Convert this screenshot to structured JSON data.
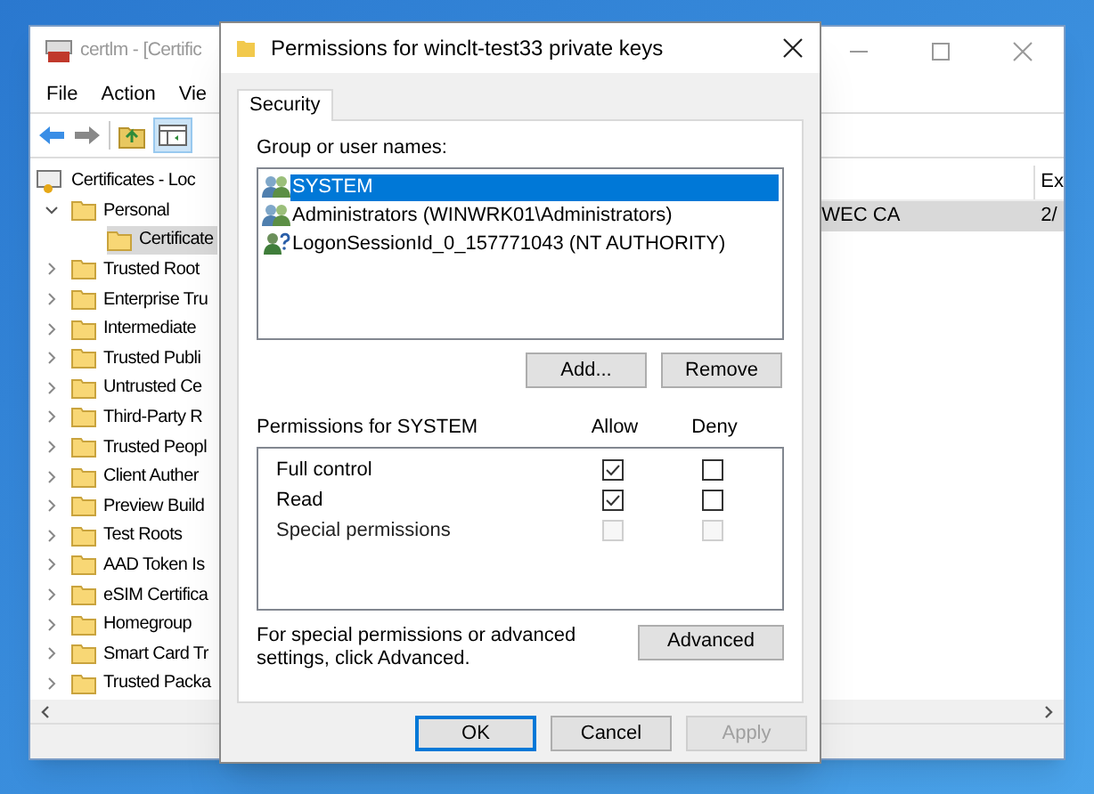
{
  "main_window": {
    "title": "certlm - [Certific",
    "menu": [
      "File",
      "Action",
      "Vie"
    ],
    "tree": {
      "label": "Certificates - Loc",
      "selected": false,
      "children": [
        {
          "label": "Personal",
          "expanded": true,
          "selected": false,
          "children": [
            {
              "label": "Certificate",
              "selected": true
            }
          ]
        },
        {
          "label": "Trusted Root",
          "expanded": false,
          "selected": false
        },
        {
          "label": "Enterprise Tru",
          "expanded": false,
          "selected": false
        },
        {
          "label": "Intermediate",
          "expanded": false,
          "selected": false
        },
        {
          "label": "Trusted Publi",
          "expanded": false,
          "selected": false
        },
        {
          "label": "Untrusted Ce",
          "expanded": false,
          "selected": false
        },
        {
          "label": "Third-Party R",
          "expanded": false,
          "selected": false
        },
        {
          "label": "Trusted Peopl",
          "expanded": false,
          "selected": false
        },
        {
          "label": "Client Auther",
          "expanded": false,
          "selected": false
        },
        {
          "label": "Preview Build",
          "expanded": false,
          "selected": false
        },
        {
          "label": "Test Roots",
          "expanded": false,
          "selected": false
        },
        {
          "label": "AAD Token Is",
          "expanded": false,
          "selected": false
        },
        {
          "label": "eSIM Certifica",
          "expanded": false,
          "selected": false
        },
        {
          "label": "Homegroup",
          "expanded": false,
          "selected": false
        },
        {
          "label": "Smart Card Tr",
          "expanded": false,
          "selected": false
        },
        {
          "label": "Trusted Packa",
          "expanded": false,
          "selected": false
        }
      ]
    },
    "list": {
      "column_2": "Ex",
      "rows": [
        {
          "cell_1": "WEC CA",
          "cell_2": "2/",
          "selected": true
        }
      ]
    }
  },
  "dialog": {
    "title": "Permissions for winclt-test33 private keys",
    "tabs": [
      {
        "label": "Security",
        "selected": true
      }
    ],
    "group_label": "Group or user names:",
    "principals": [
      {
        "name": "SYSTEM",
        "kind": "group",
        "selected": true
      },
      {
        "name": "Administrators (WINWRK01\\Administrators)",
        "kind": "group",
        "selected": false
      },
      {
        "name": "LogonSessionId_0_157771043 (NT AUTHORITY)",
        "kind": "unknown",
        "selected": false
      }
    ],
    "add_button": "Add...",
    "remove_button": "Remove",
    "permissions_label": "Permissions for SYSTEM",
    "allow_label": "Allow",
    "deny_label": "Deny",
    "permissions": [
      {
        "name": "Full control",
        "allow": {
          "checked": true,
          "disabled": false
        },
        "deny": {
          "checked": false,
          "disabled": false
        }
      },
      {
        "name": "Read",
        "allow": {
          "checked": true,
          "disabled": false
        },
        "deny": {
          "checked": false,
          "disabled": false
        }
      },
      {
        "name": "Special permissions",
        "allow": {
          "checked": false,
          "disabled": true
        },
        "deny": {
          "checked": false,
          "disabled": true
        }
      }
    ],
    "advanced_note": "For special permissions or advanced settings, click Advanced.",
    "advanced_button": "Advanced",
    "buttons": [
      {
        "label": "OK",
        "default": true,
        "disabled": false
      },
      {
        "label": "Cancel",
        "default": false,
        "disabled": false
      },
      {
        "label": "Apply",
        "default": false,
        "disabled": true
      }
    ]
  }
}
